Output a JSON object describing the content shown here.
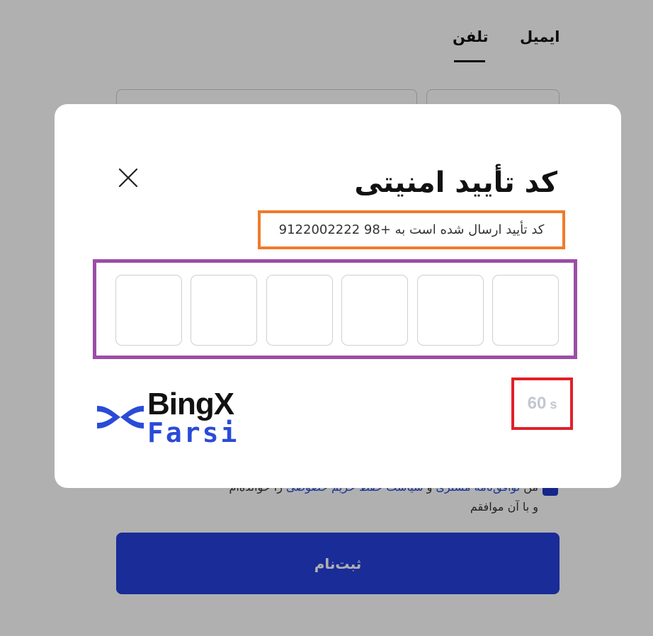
{
  "tabs": {
    "email": "ایمیل",
    "phone": "تلفن",
    "active": "phone"
  },
  "terms": {
    "prefix": "من",
    "link1": "توافق‌نامه مشتری",
    "and": "و",
    "link2": "سیاست حفظ حریم خصوصی",
    "suffix": "را خوانده‌ام",
    "line2": "و با آن موافقم",
    "checked": true
  },
  "submit_label": "ثبت‌نام",
  "modal": {
    "title": "کد تأیید امنیتی",
    "subtitle": "کد تأیید ارسال شده است به +98 9122002222",
    "otp_cells": [
      "",
      "",
      "",
      "",
      "",
      ""
    ],
    "timer_value": "60",
    "timer_unit": "s",
    "logo_line1": "BingX",
    "logo_line2": "Farsi"
  },
  "colors": {
    "accent_blue": "#2541db",
    "highlight_orange": "#f07a2b",
    "highlight_purple": "#9b4ea6",
    "highlight_red": "#e0202a"
  },
  "icons": {
    "close": "close-icon",
    "logo": "bingx-logo-icon"
  }
}
